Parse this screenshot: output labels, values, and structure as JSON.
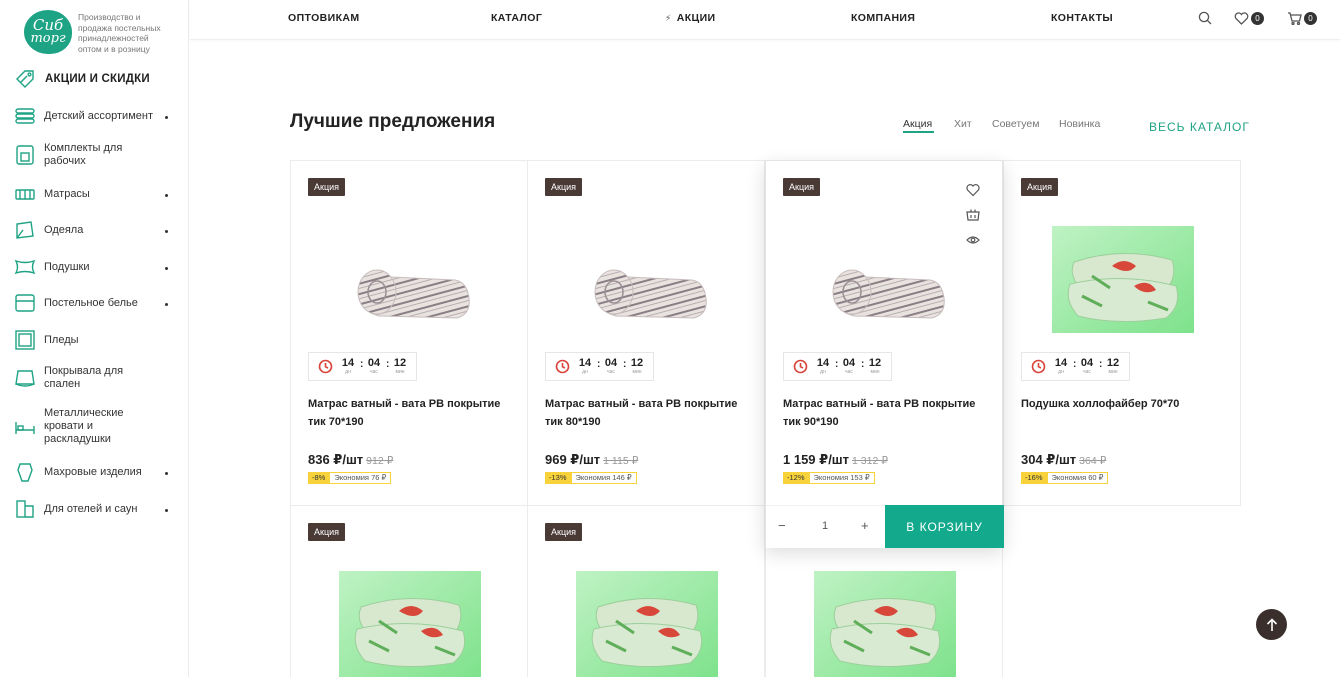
{
  "logo": {
    "line1": "Сиб",
    "line2": "торг",
    "tagline": "Производство и продажа постельных принадлежностей оптом и в розницу"
  },
  "sidebar": {
    "promo_label": "АКЦИИ И СКИДКИ",
    "items": [
      {
        "label": "Детский ассортимент",
        "icon": "kids-icon",
        "has_sub": true
      },
      {
        "label": "Комплекты для рабочих",
        "icon": "workwear-icon",
        "has_sub": false
      },
      {
        "label": "Матрасы",
        "icon": "mattress-icon",
        "has_sub": true
      },
      {
        "label": "Одеяла",
        "icon": "blanket-icon",
        "has_sub": true
      },
      {
        "label": "Подушки",
        "icon": "pillow-icon",
        "has_sub": true
      },
      {
        "label": "Постельное белье",
        "icon": "bedding-icon",
        "has_sub": true
      },
      {
        "label": "Пледы",
        "icon": "plaid-icon",
        "has_sub": false
      },
      {
        "label": "Покрывала для спален",
        "icon": "bedspread-icon",
        "has_sub": false
      },
      {
        "label": "Металлические кровати и раскладушки",
        "icon": "bed-icon",
        "has_sub": false
      },
      {
        "label": "Махровые изделия",
        "icon": "towel-icon",
        "has_sub": true
      },
      {
        "label": "Для отелей и саун",
        "icon": "hotel-icon",
        "has_sub": true
      }
    ]
  },
  "header": {
    "nav": [
      "ОПТОВИКАМ",
      "КАТАЛОГ",
      "АКЦИИ",
      "КОМПАНИЯ",
      "КОНТАКТЫ"
    ],
    "favorites_count": "0",
    "cart_count": "0"
  },
  "section": {
    "title": "Лучшие предложения",
    "tabs": [
      "Акция",
      "Хит",
      "Советуем",
      "Новинка"
    ],
    "active_tab": "Акция",
    "all_link": "ВЕСЬ КАТАЛОГ"
  },
  "timer_caps": {
    "days": "дн",
    "hours": "час",
    "minutes": "мин"
  },
  "products": [
    {
      "sticker": "Акция",
      "name": "Матрас ватный - вата РВ покрытие тик 70*190",
      "price": "836 ₽/шт",
      "old_price": "912 ₽",
      "discount": "-8%",
      "economy": "Экономия 76 ₽",
      "image": "mattress",
      "timer": {
        "days": "14",
        "hours": "04",
        "minutes": "12"
      }
    },
    {
      "sticker": "Акция",
      "name": "Матрас ватный - вата РВ покрытие тик 80*190",
      "price": "969 ₽/шт",
      "old_price": "1 115 ₽",
      "discount": "-13%",
      "economy": "Экономия 146 ₽",
      "image": "mattress",
      "timer": {
        "days": "14",
        "hours": "04",
        "minutes": "12"
      }
    },
    {
      "sticker": "Акция",
      "name": "Матрас ватный - вата РВ покрытие тик 90*190",
      "price": "1 159 ₽/шт",
      "old_price": "1 312 ₽",
      "discount": "-12%",
      "economy": "Экономия 153 ₽",
      "image": "mattress",
      "timer": {
        "days": "14",
        "hours": "04",
        "minutes": "12"
      }
    },
    {
      "sticker": "Акция",
      "name": "Подушка холлофайбер 70*70",
      "price": "304 ₽/шт",
      "old_price": "364 ₽",
      "discount": "-16%",
      "economy": "Экономия 60 ₽",
      "image": "pillow",
      "timer": {
        "days": "14",
        "hours": "04",
        "minutes": "12"
      }
    }
  ],
  "products_row2": [
    {
      "sticker": "Акция",
      "image": "pillow"
    },
    {
      "sticker": "Акция",
      "image": "pillow"
    },
    {
      "sticker": "",
      "image": "pillow"
    }
  ],
  "hover_card": {
    "qty": "1",
    "minus": "−",
    "plus": "+",
    "add_to_cart": "В КОРЗИНУ"
  },
  "colors": {
    "accent": "#13a98d",
    "sticker": "#4a3a36",
    "discount": "#f7d23a",
    "timer_icon": "#d9433a"
  }
}
